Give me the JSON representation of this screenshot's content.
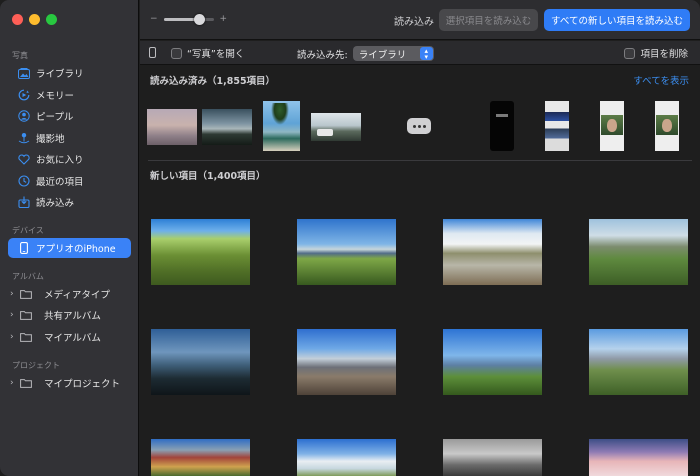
{
  "sidebar": {
    "sections": {
      "photos": "写真",
      "devices": "デバイス",
      "albums": "アルバム",
      "projects": "プロジェクト"
    },
    "photo_items": [
      {
        "label": "ライブラリ",
        "icon": "library-icon"
      },
      {
        "label": "メモリー",
        "icon": "memories-icon"
      },
      {
        "label": "ピープル",
        "icon": "people-icon"
      },
      {
        "label": "撮影地",
        "icon": "places-icon"
      },
      {
        "label": "お気に入り",
        "icon": "heart-icon"
      },
      {
        "label": "最近の項目",
        "icon": "clock-icon"
      },
      {
        "label": "読み込み",
        "icon": "import-icon"
      }
    ],
    "device_item": {
      "label": "アプリオのiPhone",
      "icon": "iphone-icon"
    },
    "album_items": [
      {
        "label": "メディアタイプ"
      },
      {
        "label": "共有アルバム"
      },
      {
        "label": "マイアルバム"
      }
    ],
    "project_items": [
      {
        "label": "マイプロジェクト"
      }
    ]
  },
  "toolbar": {
    "zoom_minus": "−",
    "zoom_plus": "+",
    "zoom_level": 0.7,
    "title": "読み込み",
    "import_selected": "選択項目を読み込む",
    "import_all": "すべての新しい項目を読み込む"
  },
  "options": {
    "open_photos_label": "“写真”を開く",
    "import_to_label": "読み込み先:",
    "import_to_value": "ライブラリ",
    "delete_label": "項目を削除"
  },
  "imported": {
    "header": "読み込み済み（1,855項目）",
    "show_all": "すべてを表示"
  },
  "new_items": {
    "header": "新しい項目（1,400項目）"
  },
  "colors": {
    "accent": "#3a82f7",
    "sidebar_bg": "#323236",
    "main_bg": "#1e1e1e"
  }
}
